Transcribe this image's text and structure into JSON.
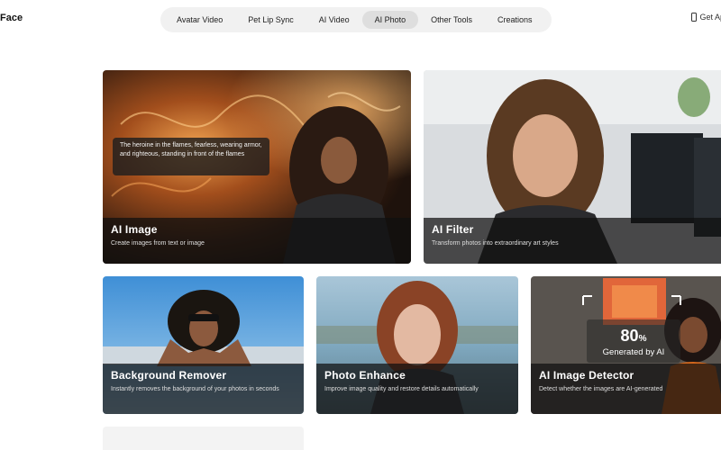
{
  "header": {
    "brand": "Face",
    "nav": [
      {
        "label": "Avatar Video",
        "active": false
      },
      {
        "label": "Pet Lip Sync",
        "active": false
      },
      {
        "label": "AI Video",
        "active": false
      },
      {
        "label": "AI Photo",
        "active": true
      },
      {
        "label": "Other Tools",
        "active": false
      },
      {
        "label": "Creations",
        "active": false
      }
    ],
    "get_app": "Get Ap",
    "get_app_icon": "phone-icon"
  },
  "cards": {
    "ai_image": {
      "title": "AI Image",
      "desc": "Create images from text or image",
      "prompt": "The heroine in the flames, fearless, wearing armor, and righteous, standing in front of the flames"
    },
    "ai_filter": {
      "title": "AI Filter",
      "desc": "Transform photos into extraordinary art styles"
    },
    "bg_remover": {
      "title": "Background Remover",
      "desc": "Instantly removes the background of your photos in seconds"
    },
    "photo_enhance": {
      "title": "Photo Enhance",
      "desc": "Improve image quality and restore details automatically"
    },
    "detector": {
      "title": "AI Image Detector",
      "desc": "Detect whether the images are AI-generated",
      "badge_value": "80",
      "badge_unit": "%",
      "badge_label": "Generated by AI"
    }
  },
  "colors": {
    "nav_bg": "#f1f1f1",
    "nav_active": "#dedede",
    "caption_bg": "#0f0f0f"
  }
}
